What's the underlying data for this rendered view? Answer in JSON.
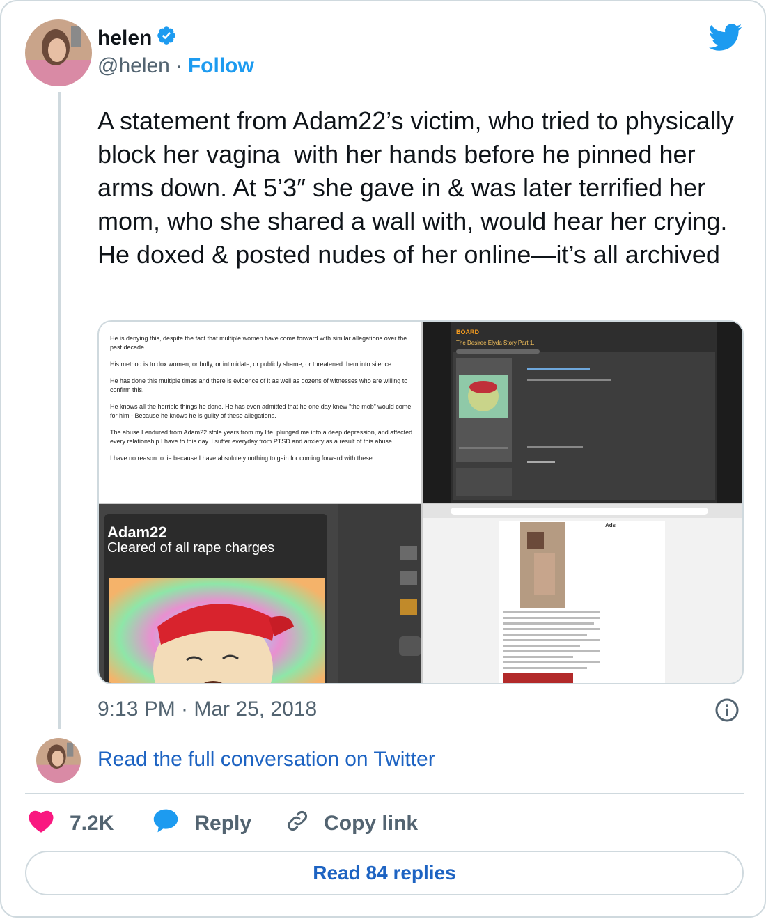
{
  "author": {
    "name": "helen",
    "handle": "@helen",
    "separator": "·",
    "follow_label": "Follow",
    "verified": true
  },
  "tweet": {
    "text": "A statement from Adam22’s victim, who tried to physically block her vagina  with her hands before he pinned her arms down. At 5’3″ she gave in & was later terrified her mom, who she shared a wall with, would hear her crying. He doxed & posted nudes of her online—it’s all archived",
    "timestamp": "9:13 PM · Mar 25, 2018"
  },
  "media": {
    "statement": [
      "He is denying this, despite the fact that multiple women have come forward with similar allegations over the past decade.",
      "His method is to dox women, or bully, or intimidate, or publicly shame, or threatened them into silence.",
      "He has done this multiple times and there is evidence of it as well as dozens of witnesses who are willing to confirm this.",
      "He knows all the horrible things he done. He has even admitted that he one day knew “the mob” would come for him - Because he knows he is guilty of these allegations.",
      "The abuse I endured from Adam22 stole years from my life, plunged me into a deep depression, and affected every relationship I have to this day. I suffer everyday from PTSD and anxiety as a result of this abuse.",
      "I have no reason to lie because I have absolutely nothing to gain for coming forward with these"
    ],
    "forum_header": "BOARD",
    "forum_title": "The Desiree Elyda Story Part 1.",
    "zoom_name": "Adam22",
    "zoom_subtitle": "Cleared of all rape charges",
    "archive_ads_label": "Ads"
  },
  "conversation_link": "Read the full conversation on Twitter",
  "actions": {
    "likes": "7.2K",
    "reply_label": "Reply",
    "copy_label": "Copy link"
  },
  "read_replies_label": "Read 84 replies",
  "colors": {
    "brand_blue": "#1d9bf0",
    "link_blue": "#1d63c2",
    "like_pink": "#f91880",
    "secondary_text": "#536471",
    "border": "#cfd9de"
  },
  "icons": [
    "avatar-image",
    "verified-badge-icon",
    "twitter-bird-icon",
    "info-icon",
    "heart-icon",
    "reply-bubble-icon",
    "link-icon"
  ]
}
